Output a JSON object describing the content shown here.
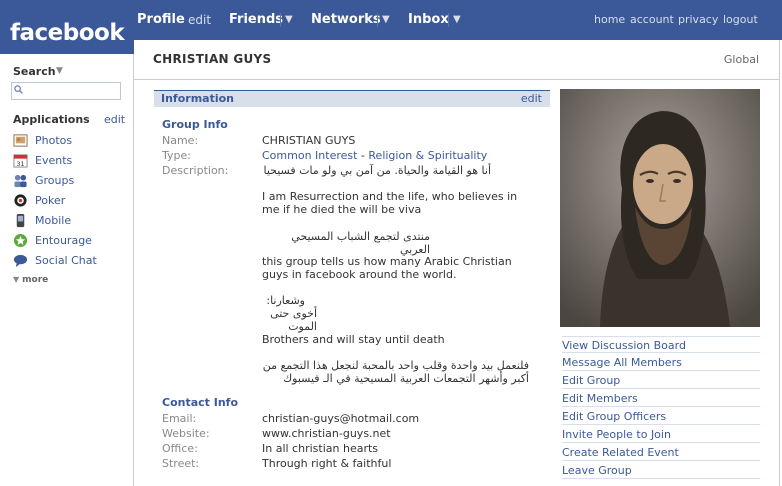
{
  "brand": {
    "logo": "facebook"
  },
  "nav": {
    "profile": "Profile",
    "profile_edit": "edit",
    "friends": "Friends",
    "networks": "Networks",
    "inbox": "Inbox",
    "dropdown_arrow": "▼",
    "links": [
      "home",
      "account",
      "privacy",
      "logout"
    ]
  },
  "sidebar": {
    "search_label": "Search",
    "search_caret": "▼",
    "search_value": "",
    "applications_title": "Applications",
    "applications_edit": "edit",
    "apps": [
      {
        "label": "Photos",
        "icon": "photos-icon"
      },
      {
        "label": "Events",
        "icon": "calendar-icon"
      },
      {
        "label": "Groups",
        "icon": "groups-icon"
      },
      {
        "label": "Poker",
        "icon": "poker-icon"
      },
      {
        "label": "Mobile",
        "icon": "mobile-icon"
      },
      {
        "label": "Entourage",
        "icon": "entourage-icon"
      },
      {
        "label": "Social Chat",
        "icon": "chat-icon"
      }
    ],
    "more": "more",
    "calendar_day": "31"
  },
  "group": {
    "title": "CHRISTIAN GUYS",
    "network": "Global"
  },
  "information": {
    "title": "Information",
    "edit": "edit",
    "group_info_title": "Group Info",
    "name_label": "Name:",
    "name": "CHRISTIAN GUYS",
    "type_label": "Type:",
    "type_category": "Common Interest",
    "type_sep": " - ",
    "type_sub": "Religion & Spirituality",
    "description_label": "Description:",
    "desc_1": "أنا هو القيامة والحياة. من آمن بي ولو مات فسيحيا",
    "desc_2": "I am Resurrection and the life, who believes in me if he died the will be viva",
    "desc_3": "منتدى لتجمع الشباب المسيحي العربي",
    "desc_4": "this group tells us how many Arabic Christian guys in facebook around the world.",
    "desc_5a": "وشعارنا:",
    "desc_5b": "أخوى حتى الموت",
    "desc_6": "Brothers and will stay until death",
    "desc_7a": "فلنعمل بيد واحدة وقلب واحد بالمحبة لنجعل هذا التجمع من",
    "desc_7b": "أكبر وأشهر التجمعات العربية المسيحية في الـ فيسبوك",
    "contact_title": "Contact Info",
    "email_label": "Email:",
    "email": "christian-guys@hotmail.com",
    "website_label": "Website:",
    "website": "www.christian-guys.net",
    "office_label": "Office:",
    "office": "In all christian hearts",
    "street_label": "Street:",
    "street": "Through right & faithful"
  },
  "actions": [
    "View Discussion Board",
    "Message All Members",
    "Edit Group",
    "Edit Members",
    "Edit Group Officers",
    "Invite People to Join",
    "Create Related Event",
    "Leave Group"
  ],
  "colors": {
    "brand_blue": "#3b5998",
    "light_blue": "#d8dfea",
    "link": "#3b5998"
  }
}
